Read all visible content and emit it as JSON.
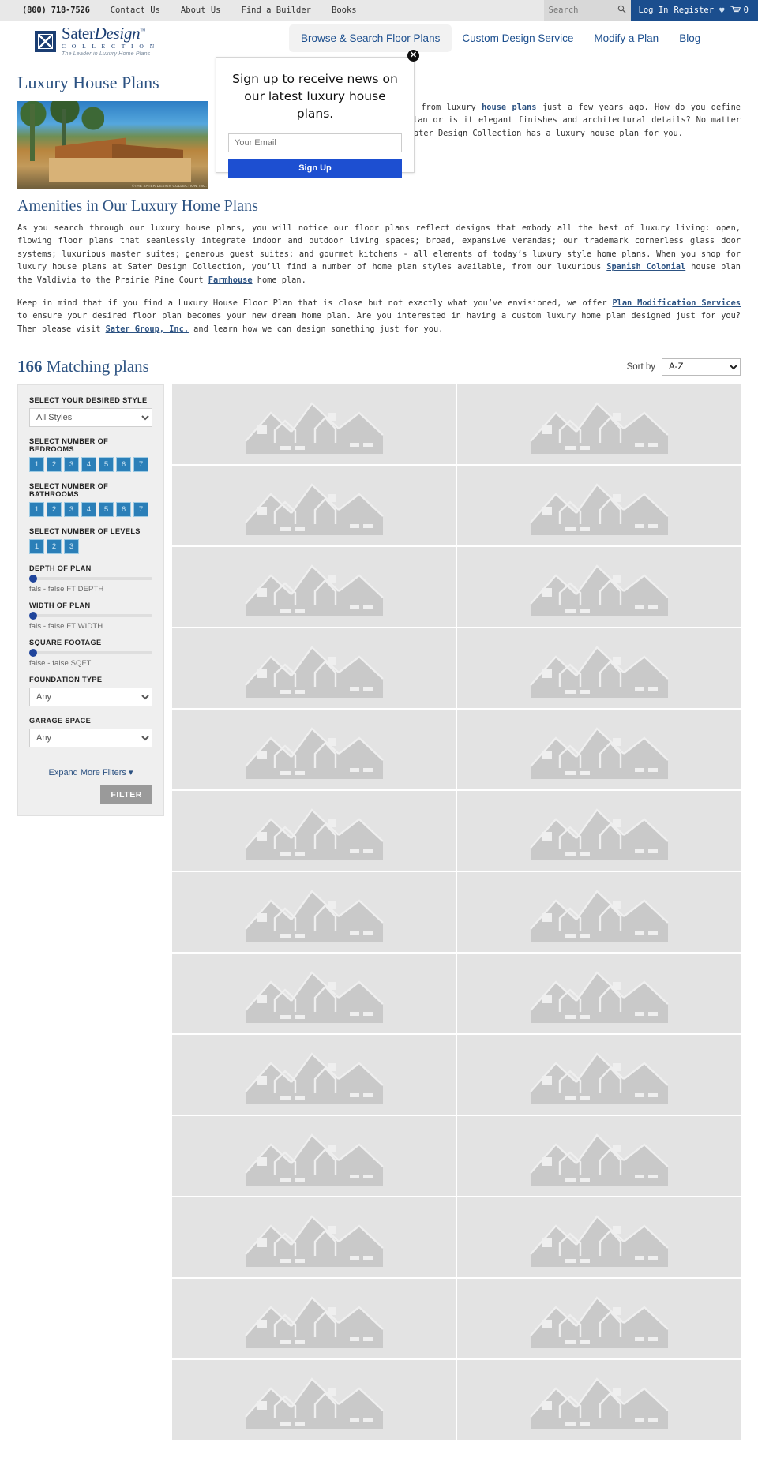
{
  "topbar": {
    "phone": "(800) 718-7526",
    "links": [
      "Contact Us",
      "About Us",
      "Find a Builder",
      "Books"
    ],
    "search_placeholder": "Search",
    "search_icon": "search-icon",
    "login": "Log In",
    "register": "Register",
    "wishlist_icon": "heart-icon",
    "cart_icon": "cart-icon",
    "cart_count": "0"
  },
  "header": {
    "logo_name": "Sater",
    "logo_name_italic": "Design",
    "logo_tm": "™",
    "logo_sub": "C O L L E C T I O N",
    "logo_tag": "The Leader in Luxury Home Plans",
    "nav": [
      {
        "label": "Browse & Search Floor Plans",
        "active": true
      },
      {
        "label": "Custom Design Service",
        "active": false
      },
      {
        "label": "Modify a Plan",
        "active": false
      },
      {
        "label": "Blog",
        "active": false
      }
    ]
  },
  "modal": {
    "heading": "Sign up to receive news on our latest luxury house plans.",
    "email_placeholder": "Your Email",
    "submit_label": "Sign Up",
    "close_icon": "close-icon",
    "close_glyph": "✕",
    "accent": "#1d4fd1"
  },
  "page": {
    "title": "Luxury House Plans",
    "hero_caption": "©THE SATER DESIGN COLLECTION, INC.",
    "intro_p1_a": "Luxury house plans have come a long way from luxury ",
    "intro_link1": "house plans",
    "intro_p1_b": " just a few years ago. How do you define luxury? Is it the sq. ft. of the home plan or is it elegant finishes and architectural details? No matter how you define your luxury dream home, Sater Design Collection has a luxury house plan for you.",
    "subtitle": "Amenities in Our Luxury Home Plans",
    "p2_a": "As you search through our luxury house plans, you will notice our floor plans reflect designs that embody all the best of luxury living: open, flowing floor plans that seamlessly integrate indoor and outdoor living spaces; broad, expansive verandas; our trademark cornerless glass door systems; luxurious master suites; generous guest suites; and gourmet kitchens - all elements of today’s luxury style home plans. When you shop for luxury house plans at Sater Design Collection, you’ll find a number of home plan styles available, from our luxurious ",
    "p2_link1": "Spanish Colonial",
    "p2_b": " house plan the Valdivia to the Prairie Pine Court ",
    "p2_link2": "Farmhouse",
    "p2_c": " home plan.",
    "p3_a": "Keep in mind that if you find a Luxury House Floor Plan that is close but not exactly what you’ve envisioned, we offer ",
    "p3_link1": "Plan Modification Services",
    "p3_b": " to ensure your desired floor plan becomes your new dream home plan. Are you interested in having a custom luxury home plan designed just for you? Then please visit ",
    "p3_link2": "Sater Group, Inc.",
    "p3_c": " and learn how we can design something just for you."
  },
  "results": {
    "count": "166",
    "count_label": " Matching plans",
    "sort_label": "Sort by",
    "sort_value": "A-Z",
    "sort_options": [
      "A-Z"
    ]
  },
  "filters": {
    "style_label": "SELECT YOUR DESIRED STYLE",
    "style_value": "All Styles",
    "style_options": [
      "All Styles"
    ],
    "bedrooms_label": "SELECT NUMBER OF BEDROOMS",
    "bedrooms": [
      "1",
      "2",
      "3",
      "4",
      "5",
      "6",
      "7"
    ],
    "bathrooms_label": "SELECT NUMBER OF BATHROOMS",
    "bathrooms": [
      "1",
      "2",
      "3",
      "4",
      "5",
      "6",
      "7"
    ],
    "levels_label": "SELECT NUMBER OF LEVELS",
    "levels": [
      "1",
      "2",
      "3"
    ],
    "depth_label": "DEPTH OF PLAN",
    "depth_range": "fals - false FT DEPTH",
    "width_label": "WIDTH OF PLAN",
    "width_range": "fals - false FT WIDTH",
    "sqft_label": "SQUARE FOOTAGE",
    "sqft_range": "false  -  false  SQFT",
    "foundation_label": "FOUNDATION TYPE",
    "foundation_value": "Any",
    "foundation_options": [
      "Any"
    ],
    "garage_label": "GARAGE SPACE",
    "garage_value": "Any",
    "garage_options": [
      "Any"
    ],
    "expand_label": "Expand More Filters",
    "expand_icon": "chevron-down-icon",
    "filter_button": "FILTER",
    "accent": "#2b7fb8"
  },
  "plan_cards": [
    {
      "placeholder_icon": "house-placeholder-icon"
    },
    {
      "placeholder_icon": "house-placeholder-icon"
    },
    {
      "placeholder_icon": "house-placeholder-icon"
    },
    {
      "placeholder_icon": "house-placeholder-icon"
    },
    {
      "placeholder_icon": "house-placeholder-icon"
    },
    {
      "placeholder_icon": "house-placeholder-icon"
    },
    {
      "placeholder_icon": "house-placeholder-icon"
    },
    {
      "placeholder_icon": "house-placeholder-icon"
    },
    {
      "placeholder_icon": "house-placeholder-icon"
    },
    {
      "placeholder_icon": "house-placeholder-icon"
    },
    {
      "placeholder_icon": "house-placeholder-icon"
    },
    {
      "placeholder_icon": "house-placeholder-icon"
    },
    {
      "placeholder_icon": "house-placeholder-icon"
    },
    {
      "placeholder_icon": "house-placeholder-icon"
    },
    {
      "placeholder_icon": "house-placeholder-icon"
    },
    {
      "placeholder_icon": "house-placeholder-icon"
    },
    {
      "placeholder_icon": "house-placeholder-icon"
    },
    {
      "placeholder_icon": "house-placeholder-icon"
    },
    {
      "placeholder_icon": "house-placeholder-icon"
    },
    {
      "placeholder_icon": "house-placeholder-icon"
    },
    {
      "placeholder_icon": "house-placeholder-icon"
    },
    {
      "placeholder_icon": "house-placeholder-icon"
    },
    {
      "placeholder_icon": "house-placeholder-icon"
    },
    {
      "placeholder_icon": "house-placeholder-icon"
    },
    {
      "placeholder_icon": "house-placeholder-icon"
    },
    {
      "placeholder_icon": "house-placeholder-icon"
    }
  ]
}
